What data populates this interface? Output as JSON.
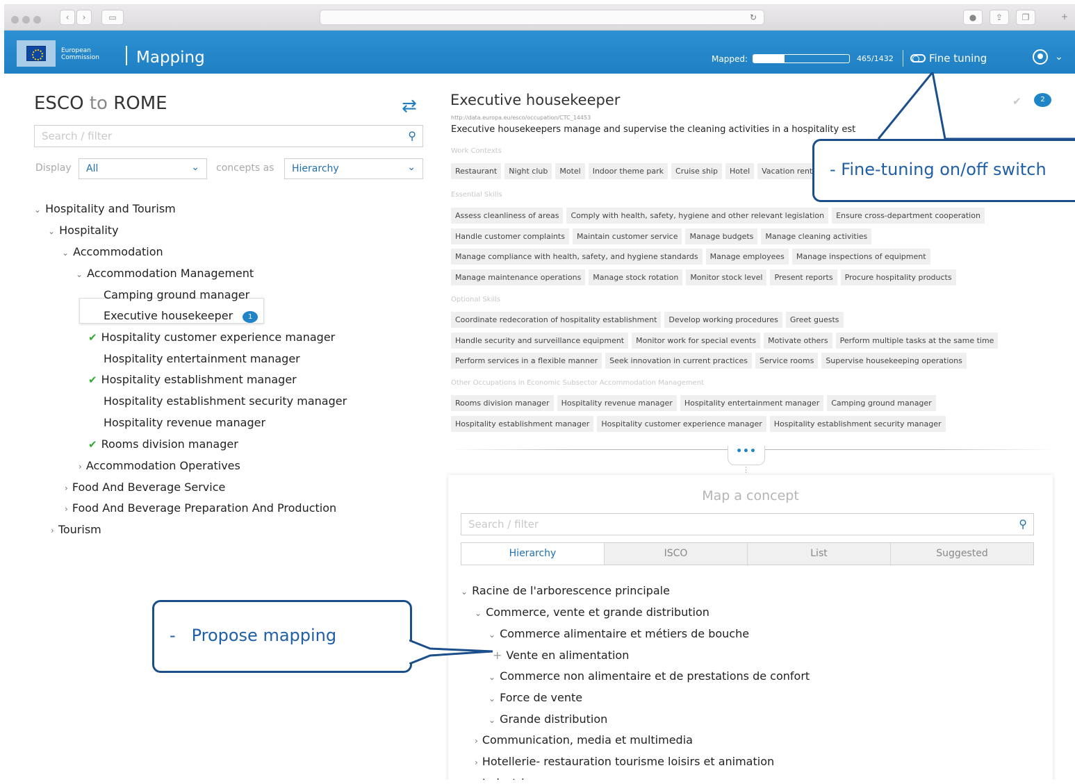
{
  "header": {
    "org_line1": "European",
    "org_line2": "Commission",
    "app_title": "Mapping",
    "mapped_label": "Mapped:",
    "mapped_fraction": 0.325,
    "mapped_count": "465/1432",
    "fine_tuning_label": "Fine tuning"
  },
  "left": {
    "title_from": "ESCO",
    "title_to_word": "to",
    "title_target": "ROME",
    "search_placeholder": "Search / filter",
    "display_label": "Display",
    "display_value": "All",
    "concepts_label": "concepts as",
    "view_value": "Hierarchy",
    "tree": [
      {
        "label": "Hospitality and Tourism",
        "arrow": "⌄",
        "check": false
      },
      {
        "label": "Hospitality",
        "arrow": "⌄",
        "check": false
      },
      {
        "label": "Accommodation",
        "arrow": "⌄",
        "check": false
      },
      {
        "label": "Accommodation Management",
        "arrow": "⌄",
        "check": false
      },
      {
        "label": "Camping ground manager",
        "arrow": "",
        "check": false
      },
      {
        "label": "Executive housekeeper",
        "arrow": "",
        "check": false,
        "badge": "1"
      },
      {
        "label": "Hospitality customer experience manager",
        "arrow": "",
        "check": true
      },
      {
        "label": "Hospitality entertainment manager",
        "arrow": "",
        "check": false
      },
      {
        "label": "Hospitality establishment manager",
        "arrow": "",
        "check": true
      },
      {
        "label": "Hospitality establishment security manager",
        "arrow": "",
        "check": false
      },
      {
        "label": "Hospitality revenue manager",
        "arrow": "",
        "check": false
      },
      {
        "label": "Rooms division manager",
        "arrow": "",
        "check": true
      },
      {
        "label": "Accommodation Operatives",
        "arrow": "›",
        "check": false
      },
      {
        "label": "Food And Beverage Service",
        "arrow": "›",
        "check": false
      },
      {
        "label": "Food And Beverage Preparation And Production",
        "arrow": "›",
        "check": false
      },
      {
        "label": "Tourism",
        "arrow": "›",
        "check": false
      }
    ]
  },
  "detail": {
    "title": "Executive housekeeper",
    "uri": "http://data.europa.eu/esco/occupation/CTC_14453",
    "description": "Executive housekeepers manage and supervise the cleaning activities in a hospitality est",
    "comment_count": "2",
    "work_contexts_label": "Work Contexts",
    "work_contexts": [
      "Restaurant",
      "Night club",
      "Motel",
      "Indoor theme park",
      "Cruise ship",
      "Hotel",
      "Vacation rental"
    ],
    "essential_label": "Essential Skills",
    "essential_rows": [
      [
        "Assess cleanliness of areas",
        "Comply with health, safety, hygiene and other relevant legislation",
        "Ensure cross-department cooperation"
      ],
      [
        "Handle customer complaints",
        "Maintain customer service",
        "Manage budgets",
        "Manage cleaning activities"
      ],
      [
        "Manage compliance with health, safety, and hygiene standards",
        "Manage employees",
        "Manage inspections of equipment"
      ],
      [
        "Manage maintenance operations",
        "Manage stock rotation",
        "Monitor stock level",
        "Present reports",
        "Procure hospitality products"
      ]
    ],
    "optional_label": "Optional Skills",
    "optional_rows": [
      [
        "Coordinate redecoration of hospitality establishment",
        "Develop working procedures",
        "Greet guests"
      ],
      [
        "Handle security and surveillance equipment",
        "Monitor work for special events",
        "Motivate others",
        "Perform multiple tasks at the same time"
      ],
      [
        "Perform services in a flexible manner",
        "Seek innovation in current practices",
        "Service rooms",
        "Supervise housekeeping operations"
      ]
    ],
    "other_label": "Other Occupations in Economic Subsector Accommodation Management",
    "other_rows": [
      [
        "Rooms division manager",
        "Hospitality revenue manager",
        "Hospitality entertainment manager",
        "Camping ground manager"
      ],
      [
        "Hospitality establishment manager",
        "Hospitality customer experience manager",
        "Hospitality establishment security manager"
      ]
    ]
  },
  "map": {
    "title": "Map a concept",
    "search_placeholder": "Search / filter",
    "tabs": [
      "Hierarchy",
      "ISCO",
      "List",
      "Suggested"
    ],
    "tree": [
      {
        "label": "Racine de l'arborescence principale",
        "arrow": "⌄"
      },
      {
        "label": "Commerce, vente et grande distribution",
        "arrow": "⌄"
      },
      {
        "label": "Commerce alimentaire et métiers de bouche",
        "arrow": "⌄"
      },
      {
        "label": "Vente en alimentation",
        "arrow": "+"
      },
      {
        "label": "Commerce non alimentaire et de prestations de confort",
        "arrow": "⌄"
      },
      {
        "label": "Force de vente",
        "arrow": "⌄"
      },
      {
        "label": "Grande distribution",
        "arrow": "⌄"
      },
      {
        "label": "Communication, media et multimedia",
        "arrow": "›"
      },
      {
        "label": "Hotellerie- restauration tourisme loisirs et animation",
        "arrow": "›"
      },
      {
        "label": "Industrie",
        "arrow": "›"
      }
    ]
  },
  "callouts": {
    "fine_tuning": "- Fine-tuning on/off switch",
    "propose_prefix": "-",
    "propose": "Propose mapping"
  }
}
